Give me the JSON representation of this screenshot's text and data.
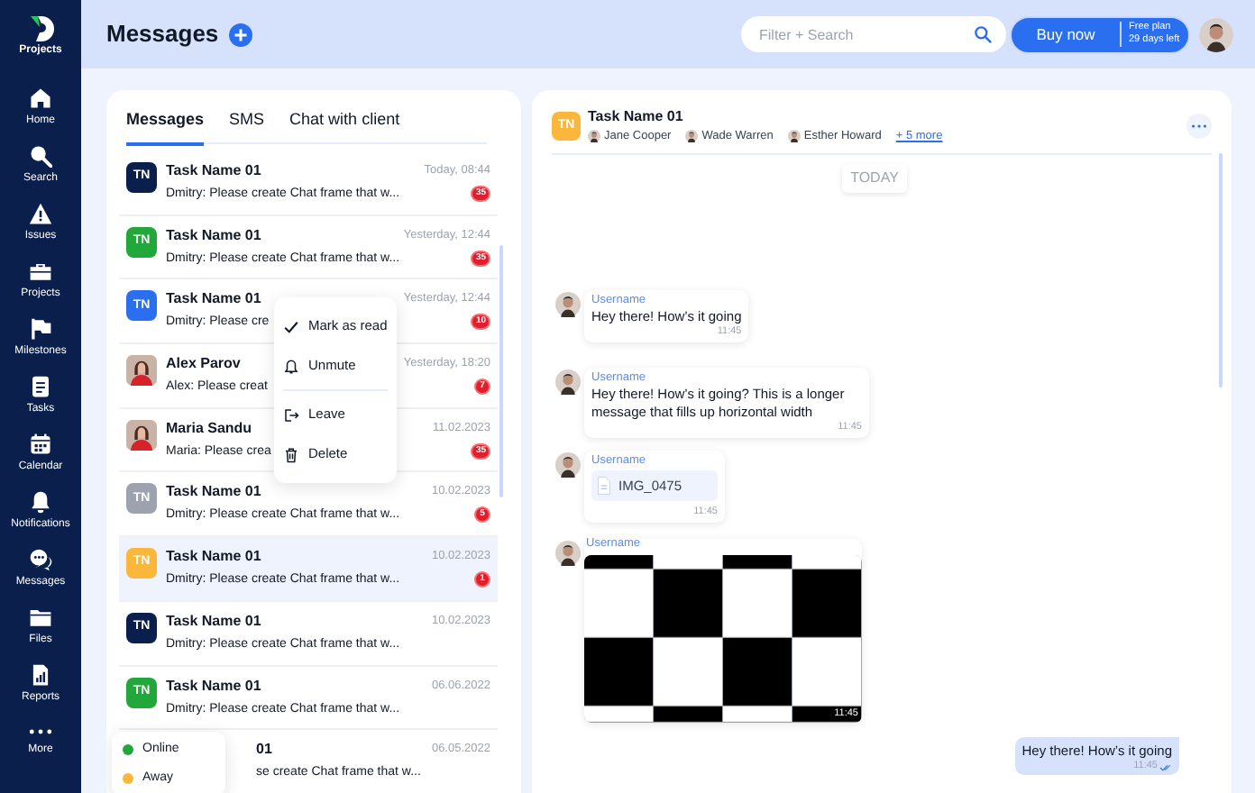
{
  "sidebar": {
    "logo_label": "Projects",
    "items": [
      {
        "label": "Home"
      },
      {
        "label": "Search"
      },
      {
        "label": "Issues"
      },
      {
        "label": "Projects"
      },
      {
        "label": "Milestones"
      },
      {
        "label": "Tasks"
      },
      {
        "label": "Calendar"
      },
      {
        "label": "Notifications"
      },
      {
        "label": "Messages"
      },
      {
        "label": "Files"
      },
      {
        "label": "Reports"
      },
      {
        "label": "More"
      }
    ]
  },
  "header": {
    "title": "Messages",
    "search": {
      "placeholder": "Filter + Search"
    },
    "buy_button": {
      "label": "Buy now",
      "plan": "Free plan",
      "days_left": "29 days left"
    }
  },
  "tabs": [
    {
      "label": "Messages",
      "selected": true
    },
    {
      "label": "SMS",
      "selected": false
    },
    {
      "label": "Chat with client",
      "selected": false
    }
  ],
  "conversations": [
    {
      "kind": "initials",
      "initials": "TN",
      "color": "#0b1f4d",
      "title": "Task Name 01",
      "preview": "Dmitry: Please create Chat frame that w...",
      "date": "Today, 08:44",
      "badge": "35",
      "selected": false
    },
    {
      "kind": "initials",
      "initials": "TN",
      "color": "#22a83a",
      "title": "Task Name 01",
      "preview": "Dmitry: Please create Chat frame that w...",
      "date": "Yesterday, 12:44",
      "badge": "35",
      "selected": false
    },
    {
      "kind": "initials",
      "initials": "TN",
      "color": "#2a6ff0",
      "title": "Task Name 01",
      "preview": "Dmitry: Please cre",
      "date": "Yesterday, 12:44",
      "badge": "10",
      "selected": false
    },
    {
      "title": "Alex Parov",
      "preview": "Alex: Please creat",
      "date": "Yesterday, 18:20",
      "badge": "7",
      "selected": false
    },
    {
      "title": "Maria Sandu",
      "preview": "Maria: Please crea",
      "date": "11.02.2023",
      "badge": "35",
      "selected": false
    },
    {
      "kind": "initials",
      "initials": "TN",
      "color": "#9ca3af",
      "title": "Task Name 01",
      "preview": "Dmitry: Please create Chat frame that w...",
      "date": "10.02.2023",
      "badge": "5",
      "selected": false
    },
    {
      "kind": "initials",
      "initials": "TN",
      "color": "#fbb73c",
      "title": "Task Name 01",
      "preview": "Dmitry: Please create Chat frame that w...",
      "date": "10.02.2023",
      "badge": "1",
      "selected": true
    },
    {
      "kind": "initials",
      "initials": "TN",
      "color": "#0b1f4d",
      "title": "Task Name 01",
      "preview": "Dmitry: Please create Chat frame that w...",
      "date": "10.02.2023",
      "selected": false
    },
    {
      "kind": "initials",
      "initials": "TN",
      "color": "#22a83a",
      "title": "Task Name 01",
      "preview": "Dmitry: Please create Chat frame that w...",
      "date": "06.06.2022",
      "selected": false
    },
    {
      "kind": "covered",
      "title": "01",
      "preview": "se create Chat frame that w...",
      "date": "06.05.2022",
      "selected": false
    }
  ],
  "context_menu": [
    {
      "label": "Mark as read"
    },
    {
      "label": "Unmute"
    },
    {
      "label": "Leave"
    },
    {
      "label": "Delete"
    }
  ],
  "status_menu": [
    {
      "label": "Online",
      "color": "#22a83a"
    },
    {
      "label": "Away",
      "color": "#fbb73c"
    }
  ],
  "chat": {
    "initials": "TN",
    "title": "Task Name 01",
    "members": [
      "Jane Cooper",
      "Wade Warren",
      "Esther Howard"
    ],
    "more_link": "+ 5 more",
    "date_chip": "TODAY",
    "messages": [
      {
        "kind": "text",
        "username": "Username",
        "text": "Hey there! How’s it going",
        "time": "11:45"
      },
      {
        "kind": "text",
        "username": "Username",
        "text": "Hey there! How’s it going? This is a longer message that fills up horizontal width",
        "time": "11:45"
      },
      {
        "kind": "file",
        "username": "Username",
        "file": "IMG_0475",
        "time": "11:45"
      },
      {
        "username": "Username",
        "time": "11:45"
      },
      {
        "kind": "outgoing",
        "text": "Hey there! How’s it going",
        "time": "11:45"
      }
    ]
  }
}
